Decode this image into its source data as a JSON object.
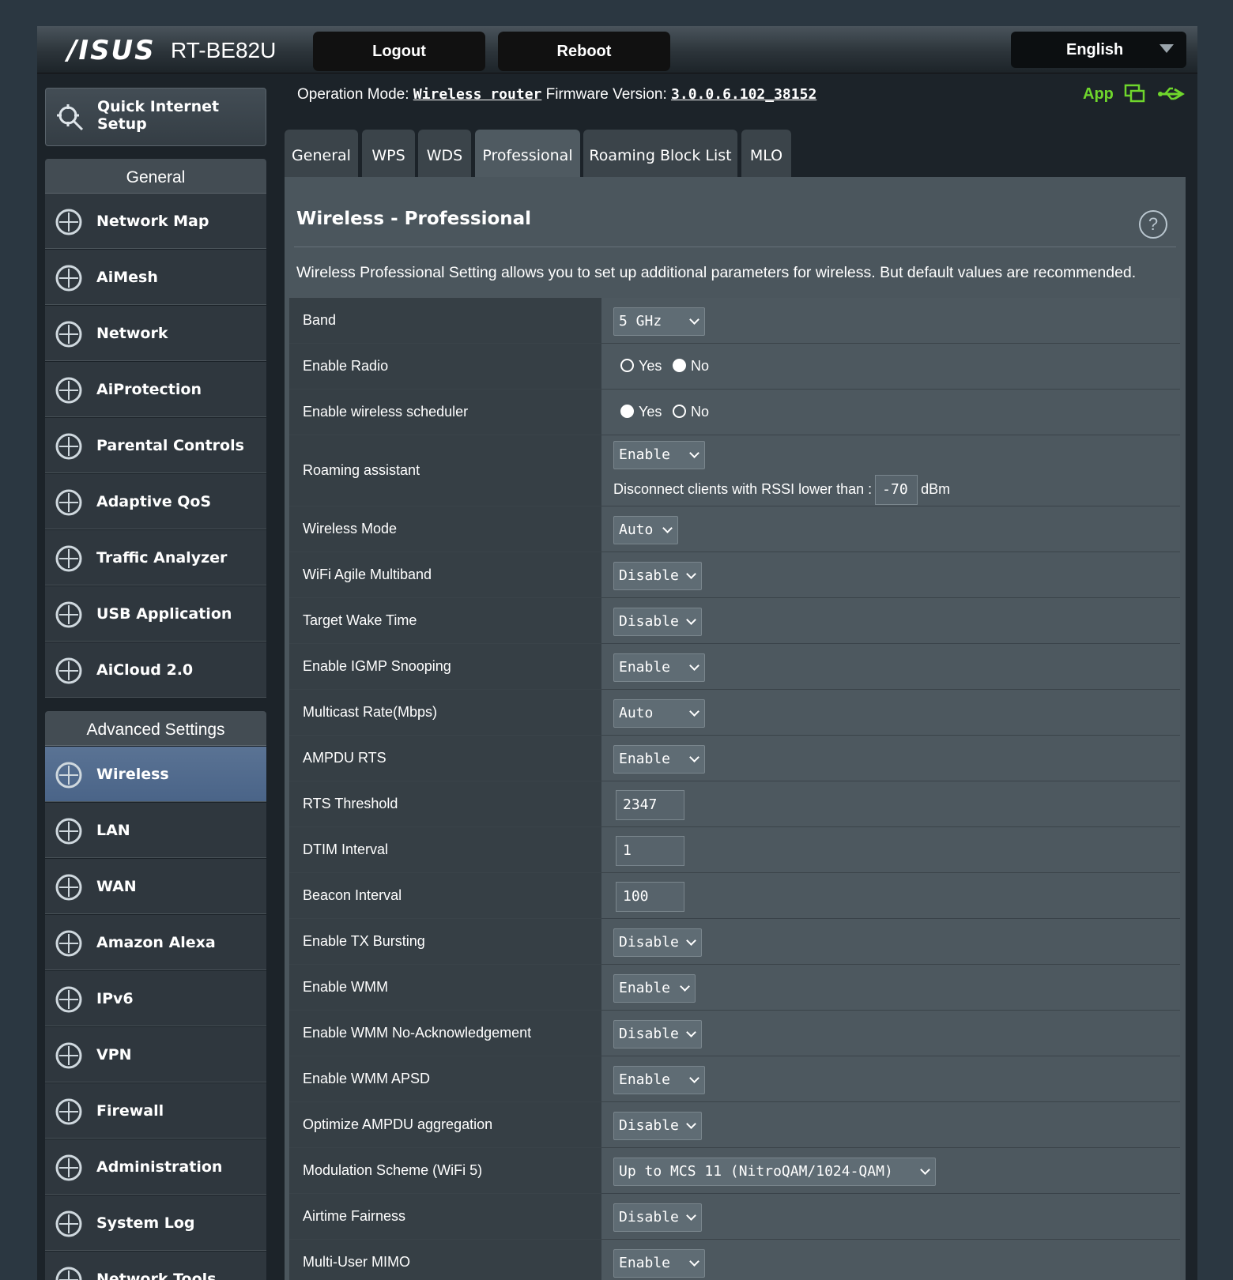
{
  "header": {
    "brand": "/ISUS",
    "model": "RT-BE82U",
    "logout": "Logout",
    "reboot": "Reboot",
    "language": "English",
    "op_mode_label": "Operation Mode:",
    "op_mode_value": "Wireless router",
    "firmware_label": "Firmware Version:",
    "firmware_value": "3.0.0.6.102_38152",
    "app_label": "App"
  },
  "sidebar": {
    "quick_setup": "Quick Internet Setup",
    "general_header": "General",
    "general_items": [
      {
        "label": "Network Map",
        "icon": "network-map-icon"
      },
      {
        "label": "AiMesh",
        "icon": "aimesh-icon"
      },
      {
        "label": "Network",
        "icon": "network-icon"
      },
      {
        "label": "AiProtection",
        "icon": "shield-lock-icon"
      },
      {
        "label": "Parental Controls",
        "icon": "parental-controls-icon"
      },
      {
        "label": "Adaptive QoS",
        "icon": "speedometer-icon"
      },
      {
        "label": "Traffic Analyzer",
        "icon": "traffic-analyzer-icon"
      },
      {
        "label": "USB Application",
        "icon": "usb-icon"
      },
      {
        "label": "AiCloud 2.0",
        "icon": "cloud-icon"
      }
    ],
    "advanced_header": "Advanced Settings",
    "advanced_items": [
      {
        "label": "Wireless",
        "icon": "wireless-icon"
      },
      {
        "label": "LAN",
        "icon": "lan-icon"
      },
      {
        "label": "WAN",
        "icon": "globe-icon"
      },
      {
        "label": "Amazon Alexa",
        "icon": "alexa-icon"
      },
      {
        "label": "IPv6",
        "icon": "ipv6-icon"
      },
      {
        "label": "VPN",
        "icon": "vpn-icon"
      },
      {
        "label": "Firewall",
        "icon": "firewall-icon"
      },
      {
        "label": "Administration",
        "icon": "gear-icon"
      },
      {
        "label": "System Log",
        "icon": "system-log-icon"
      },
      {
        "label": "Network Tools",
        "icon": "toolbox-icon"
      }
    ]
  },
  "tabs": [
    "General",
    "WPS",
    "WDS",
    "Professional",
    "Roaming Block List",
    "MLO"
  ],
  "page": {
    "title": "Wireless - Professional",
    "description": "Wireless Professional Setting allows you to set up additional parameters for wireless. But default values are recommended.",
    "help": "?"
  },
  "settings": {
    "band": {
      "label": "Band",
      "value": "5 GHz"
    },
    "enable_radio": {
      "label": "Enable Radio",
      "yes": "Yes",
      "no": "No",
      "selected": "No"
    },
    "scheduler": {
      "label": "Enable wireless scheduler",
      "yes": "Yes",
      "no": "No",
      "selected": "Yes"
    },
    "roaming": {
      "label": "Roaming assistant",
      "value": "Enable",
      "rssi_text": "Disconnect clients with RSSI lower than :",
      "rssi_value": "-70",
      "rssi_unit": "dBm"
    },
    "wireless_mode": {
      "label": "Wireless Mode",
      "value": "Auto"
    },
    "agile": {
      "label": "WiFi Agile Multiband",
      "value": "Disable"
    },
    "twt": {
      "label": "Target Wake Time",
      "value": "Disable"
    },
    "igmp": {
      "label": "Enable IGMP Snooping",
      "value": "Enable"
    },
    "multicast": {
      "label": "Multicast Rate(Mbps)",
      "value": "Auto"
    },
    "ampdu_rts": {
      "label": "AMPDU RTS",
      "value": "Enable"
    },
    "rts": {
      "label": "RTS Threshold",
      "value": "2347"
    },
    "dtim": {
      "label": "DTIM Interval",
      "value": "1"
    },
    "beacon": {
      "label": "Beacon Interval",
      "value": "100"
    },
    "tx_burst": {
      "label": "Enable TX Bursting",
      "value": "Disable"
    },
    "wmm": {
      "label": "Enable WMM",
      "value": "Enable"
    },
    "wmm_noack": {
      "label": "Enable WMM No-Acknowledgement",
      "value": "Disable"
    },
    "wmm_apsd": {
      "label": "Enable WMM APSD",
      "value": "Enable"
    },
    "ampdu_agg": {
      "label": "Optimize AMPDU aggregation",
      "value": "Disable"
    },
    "modulation": {
      "label": "Modulation Scheme (WiFi 5)",
      "value": "Up to MCS 11 (NitroQAM/1024-QAM)"
    },
    "airtime": {
      "label": "Airtime Fairness",
      "value": "Disable"
    },
    "mu_mimo": {
      "label": "Multi-User MIMO",
      "value": "Enable"
    }
  }
}
